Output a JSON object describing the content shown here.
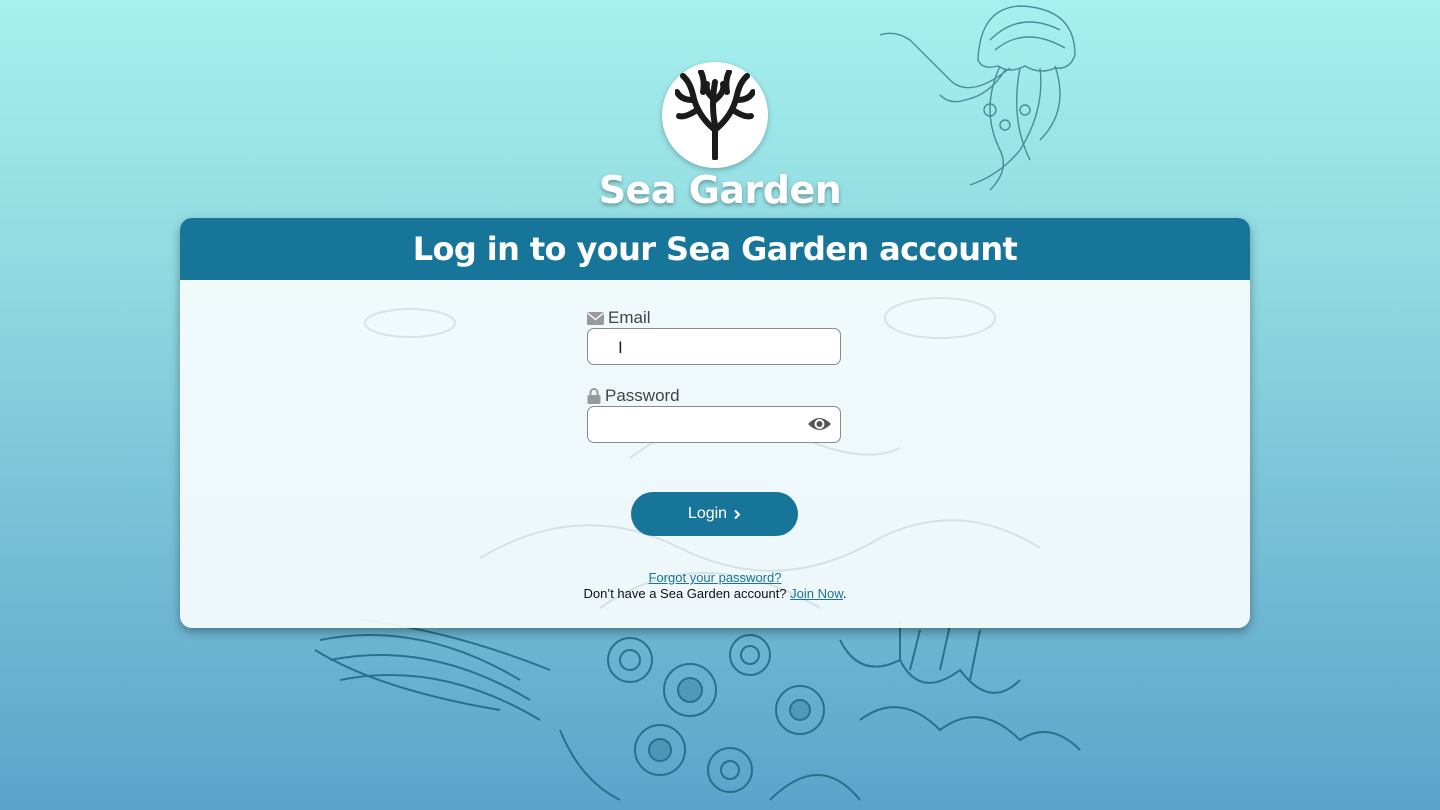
{
  "brand": {
    "name": "Sea Garden"
  },
  "login": {
    "heading": "Log in to your Sea Garden account",
    "email_label": "Email",
    "email_value": "",
    "password_label": "Password",
    "password_value": "",
    "submit_label": "Login",
    "forgot_link": "Forgot your password?",
    "signup_prompt": "Don’t have a Sea Garden account?",
    "signup_link": "Join Now",
    "signup_end": "."
  },
  "icons": {
    "logo": "coral-logo-icon",
    "email": "envelope-icon",
    "password": "lock-icon",
    "show_password": "eye-icon",
    "submit": "chevron-right-icon"
  },
  "colors": {
    "accent": "#17759a",
    "background_top": "#a6f0ef",
    "background_bottom": "#5aa4cb",
    "card": "#f8fcfd"
  }
}
